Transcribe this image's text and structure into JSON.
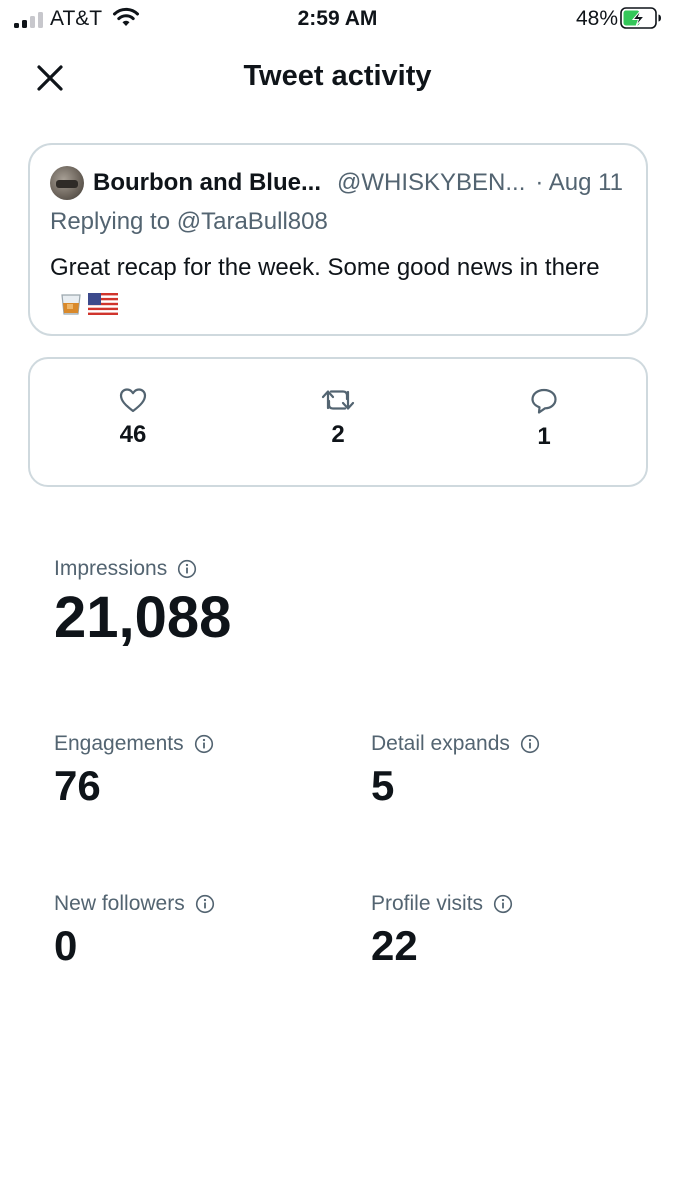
{
  "status_bar": {
    "carrier": "AT&T",
    "time": "2:59 AM",
    "battery_percent": "48%"
  },
  "header": {
    "title": "Tweet activity",
    "close_icon": "close-icon"
  },
  "tweet": {
    "author_name": "Bourbon and Blue...",
    "author_handle": "@WHISKYBEN...",
    "date": "· Aug 11",
    "replying_to": "Replying to @TaraBull808",
    "text": "Great recap for the week. Some good news in there",
    "emojis": [
      "whisky-glass-emoji",
      "us-flag-emoji"
    ]
  },
  "engagement": {
    "likes": {
      "icon": "heart-icon",
      "count": "46"
    },
    "retweets": {
      "icon": "retweet-icon",
      "count": "2"
    },
    "replies": {
      "icon": "reply-icon",
      "count": "1"
    }
  },
  "metrics": {
    "impressions": {
      "label": "Impressions",
      "value": "21,088"
    },
    "engagements": {
      "label": "Engagements",
      "value": "76"
    },
    "detail_expands": {
      "label": "Detail expands",
      "value": "5"
    },
    "new_followers": {
      "label": "New followers",
      "value": "0"
    },
    "profile_visits": {
      "label": "Profile visits",
      "value": "22"
    }
  },
  "colors": {
    "text_primary": "#0f1419",
    "text_secondary": "#536471",
    "border": "#cfd9de",
    "battery_charging": "#34c759"
  }
}
